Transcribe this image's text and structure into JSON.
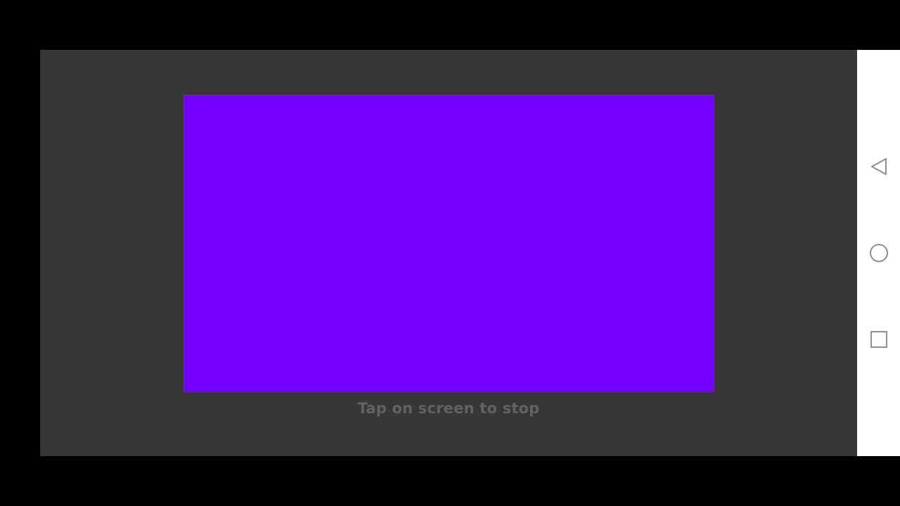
{
  "screen": {
    "background_color": "#383636",
    "color_panel": {
      "fill_color": "#7300ff"
    },
    "hint_text": "Tap on screen to stop"
  },
  "nav_bar": {
    "background_color": "#ffffff",
    "buttons": [
      {
        "icon": "back-triangle-icon"
      },
      {
        "icon": "home-circle-icon"
      },
      {
        "icon": "recents-square-icon"
      }
    ]
  }
}
